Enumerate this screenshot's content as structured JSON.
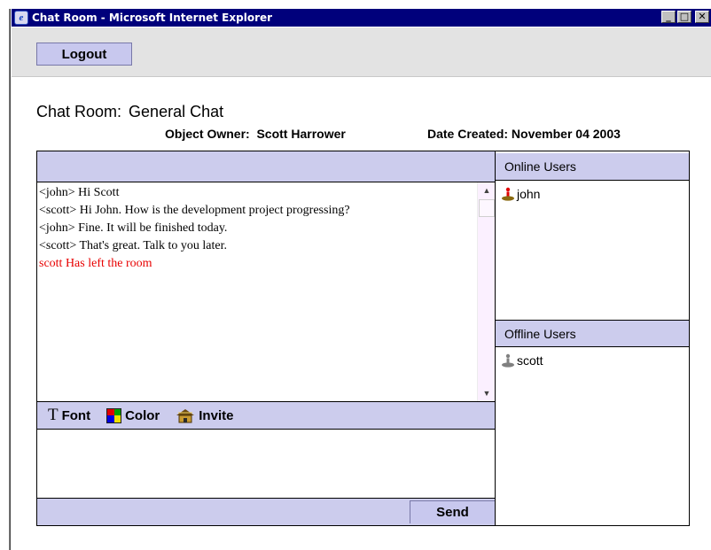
{
  "window": {
    "title": "Chat Room - Microsoft Internet Explorer",
    "minimize_label": "_",
    "maximize_label": "□",
    "close_label": "✕"
  },
  "toolbar": {
    "logout_label": "Logout"
  },
  "header": {
    "room_prefix": "Chat Room:",
    "room_name": "General Chat",
    "owner_label": "Object Owner:",
    "owner_name": "Scott Harrower",
    "date_label": "Date Created:",
    "date_value": "November 04 2003"
  },
  "messages": [
    {
      "text": "<john> Hi Scott",
      "system": false
    },
    {
      "text": "<scott>  Hi John. How is the development project progressing?",
      "system": false
    },
    {
      "text": "<john> Fine. It will be finished today.",
      "system": false
    },
    {
      "text": "<scott>  That's great. Talk to you later.",
      "system": false
    },
    {
      "text": "scott Has left the room",
      "system": true
    }
  ],
  "format_bar": {
    "font_label": "Font",
    "font_glyph": "T",
    "color_label": "Color",
    "invite_label": "Invite"
  },
  "composer": {
    "value": "",
    "send_label": "Send"
  },
  "users": {
    "online_title": "Online Users",
    "online": [
      "john"
    ],
    "offline_title": "Offline Users",
    "offline": [
      "scott"
    ]
  },
  "colors": {
    "panel_bg": "#cccced",
    "system_message": "#e80000",
    "online_user_body": "#8a6a10",
    "online_user_head": "#e00000",
    "offline_user": "#808080"
  }
}
